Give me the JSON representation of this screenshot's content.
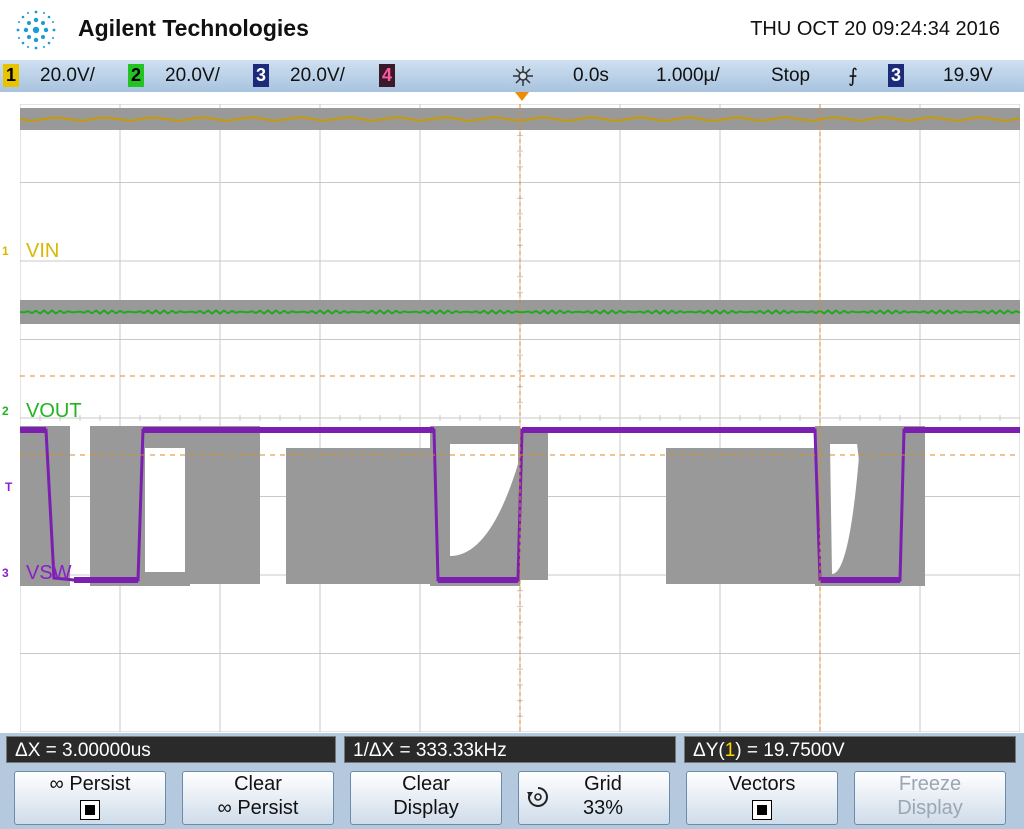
{
  "header": {
    "brand": "Agilent Technologies",
    "datetime": "THU OCT 20 09:24:34 2016"
  },
  "status_bar": {
    "channels": [
      {
        "number": "1",
        "scale": "20.0V/",
        "color": "#e8c400"
      },
      {
        "number": "2",
        "scale": "20.0V/",
        "color": "#22c322"
      },
      {
        "number": "3",
        "scale": "20.0V/",
        "color": "#2a3cc8"
      },
      {
        "number": "4",
        "scale": "",
        "color": "#e0407a"
      }
    ],
    "trigger_delay": "0.0s",
    "timebase": "1.000µ/",
    "run_state": "Stop",
    "trigger_slope_glyph": "⨍",
    "trigger_channel": "3",
    "trigger_level": "19.9V"
  },
  "waveform": {
    "channel_labels": [
      {
        "num": "1",
        "name": "VIN",
        "color": "#d9b800"
      },
      {
        "num": "2",
        "name": "VOUT",
        "color": "#22b322"
      },
      {
        "num": "3",
        "name": "VSW",
        "color": "#8a1fc8"
      }
    ],
    "trigger_marker": "T",
    "trigger_marker_color": "#8a1fc8",
    "colors": {
      "grid": "#c8c8c8",
      "persistence": "#999999",
      "vin": "#c89a00",
      "vout": "#1faa1f",
      "vsw": "#7a1fb0",
      "cursor": "#e08a20"
    }
  },
  "measurements": {
    "delta_x": "ΔX = 3.00000us",
    "inv_delta_x": "1/ΔX = 333.33kHz",
    "delta_y_prefix": "ΔY(",
    "delta_y_channel": "1",
    "delta_y_suffix": ") = 19.7500V"
  },
  "softkeys": [
    {
      "line1": "∞ Persist",
      "line2": "",
      "checkbox": true,
      "enabled": true
    },
    {
      "line1": "Clear",
      "line2": "∞ Persist",
      "checkbox": false,
      "enabled": true
    },
    {
      "line1": "Clear",
      "line2": "Display",
      "checkbox": false,
      "enabled": true
    },
    {
      "line1": "Grid",
      "line2": "33%",
      "checkbox": false,
      "enabled": true,
      "knob": true
    },
    {
      "line1": "Vectors",
      "line2": "",
      "checkbox": true,
      "enabled": true
    },
    {
      "line1": "Freeze",
      "line2": "Display",
      "checkbox": false,
      "enabled": false
    }
  ]
}
